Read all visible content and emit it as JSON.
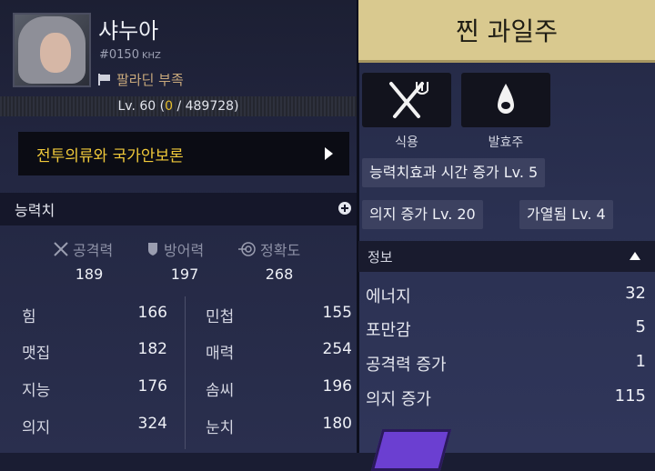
{
  "character": {
    "name": "샤누아",
    "id": "#0150",
    "id_unit": "KHZ",
    "guild": "팔라딘 부족",
    "level_prefix": "Lv. 60 (",
    "exp_current": "0",
    "exp_rest": " / 489728)"
  },
  "quest": {
    "label": "전투의류와 국가안보론"
  },
  "stats_section": {
    "title": "능력치",
    "combat": [
      {
        "label": "공격력",
        "value": "189",
        "icon": "crossed-swords-icon"
      },
      {
        "label": "방어력",
        "value": "197",
        "icon": "shield-icon"
      },
      {
        "label": "정확도",
        "value": "268",
        "icon": "target-icon"
      }
    ],
    "left": [
      {
        "label": "힘",
        "value": "166"
      },
      {
        "label": "맷집",
        "value": "182"
      },
      {
        "label": "지능",
        "value": "176"
      },
      {
        "label": "의지",
        "value": "324"
      }
    ],
    "right": [
      {
        "label": "민첩",
        "value": "155"
      },
      {
        "label": "매력",
        "value": "254"
      },
      {
        "label": "솜씨",
        "value": "196"
      },
      {
        "label": "눈치",
        "value": "180"
      }
    ]
  },
  "item": {
    "title": "찐 과일주",
    "actions": [
      {
        "label": "식용",
        "icon": "fork-knife-icon"
      },
      {
        "label": "발효주",
        "icon": "drop-icon"
      }
    ],
    "tags": [
      "능력치효과 시간 증가 Lv. 5",
      "의지 증가 Lv. 20",
      "가열됨 Lv. 4"
    ],
    "info": {
      "title": "정보",
      "rows": [
        {
          "label": "에너지",
          "value": "32"
        },
        {
          "label": "포만감",
          "value": "5"
        },
        {
          "label": "공격력 증가",
          "value": "1"
        },
        {
          "label": "의지 증가",
          "value": "115"
        }
      ]
    }
  },
  "colors": {
    "gold_text": "#f0c93a",
    "title_bar": "#d9c98f"
  }
}
